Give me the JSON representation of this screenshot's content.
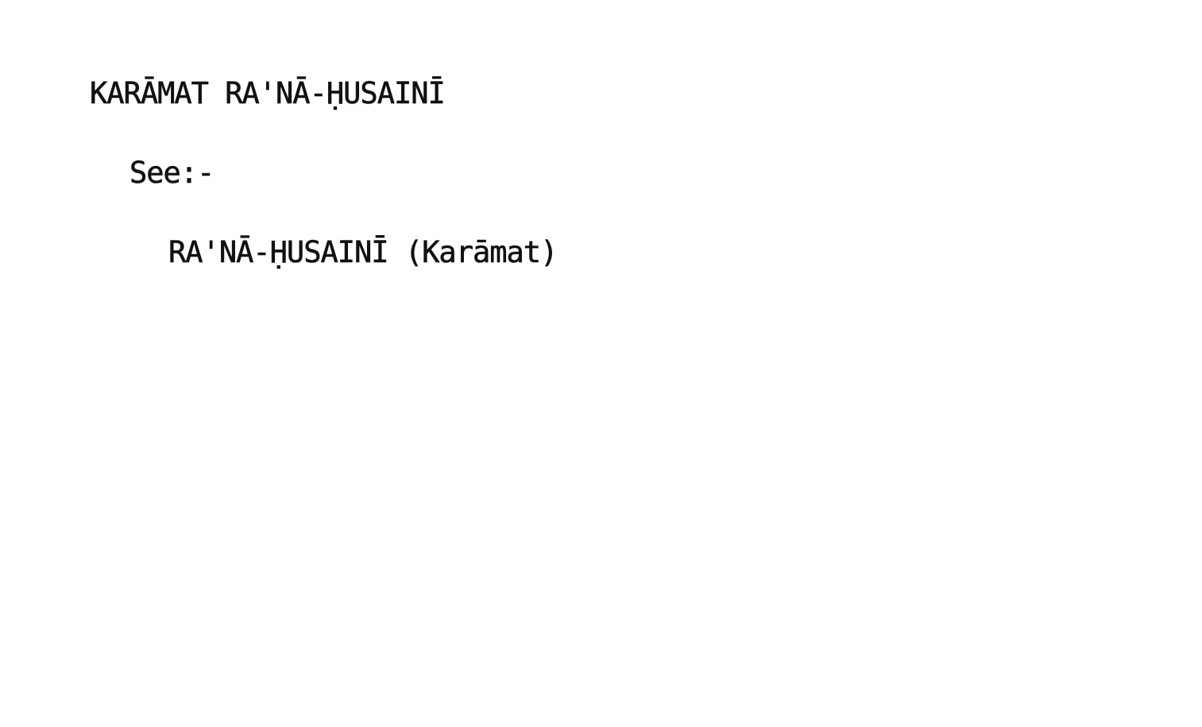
{
  "card": {
    "heading": "KARĀMAT RA'NĀ-ḤUSAINĪ",
    "see_label": "See:-",
    "reference": "RA'NĀ-ḤUSAINĪ (Karāmat)"
  }
}
